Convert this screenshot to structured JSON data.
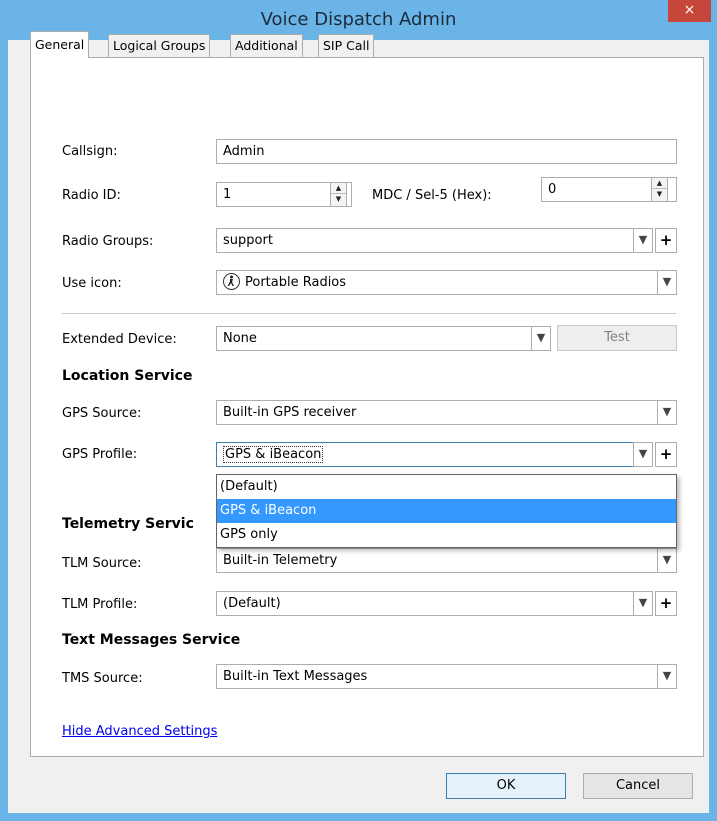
{
  "window": {
    "title": "Voice Dispatch Admin",
    "close_label": "×"
  },
  "tabs": [
    {
      "label": "General",
      "active": true
    },
    {
      "label": "Logical Groups",
      "active": false
    },
    {
      "label": "Additional",
      "active": false
    },
    {
      "label": "SIP Call",
      "active": false
    }
  ],
  "fields": {
    "callsign": {
      "label": "Callsign:",
      "value": "Admin"
    },
    "radio_id": {
      "label": "Radio ID:",
      "value": "1"
    },
    "mdc": {
      "label": "MDC / Sel-5 (Hex):",
      "value": "0"
    },
    "radio_groups": {
      "label": "Radio Groups:",
      "value": "support"
    },
    "use_icon": {
      "label": "Use icon:",
      "value": "Portable Radios",
      "icon": "portable-radio-icon"
    },
    "extended_device": {
      "label": "Extended Device:",
      "value": "None",
      "test_button": "Test"
    }
  },
  "sections": {
    "location": {
      "heading": "Location Service",
      "gps_source": {
        "label": "GPS Source:",
        "value": "Built-in GPS receiver"
      },
      "gps_profile": {
        "label": "GPS Profile:",
        "value": "GPS & iBeacon",
        "options": [
          "(Default)",
          "GPS & iBeacon",
          "GPS only"
        ],
        "selected_index": 1
      }
    },
    "telemetry": {
      "heading": "Telemetry Servic",
      "tlm_source": {
        "label": "TLM Source:",
        "value": "Built-in Telemetry"
      },
      "tlm_profile": {
        "label": "TLM Profile:",
        "value": "(Default)"
      }
    },
    "text_messages": {
      "heading": "Text Messages Service",
      "tms_source": {
        "label": "TMS Source:",
        "value": "Built-in Text Messages"
      }
    }
  },
  "link": {
    "label": "Hide Advanced Settings"
  },
  "buttons": {
    "ok": "OK",
    "cancel": "Cancel"
  },
  "colors": {
    "titlebar": "#6ab4e8",
    "close": "#c7463c",
    "selection": "#3399ff",
    "link": "#0000ee"
  }
}
